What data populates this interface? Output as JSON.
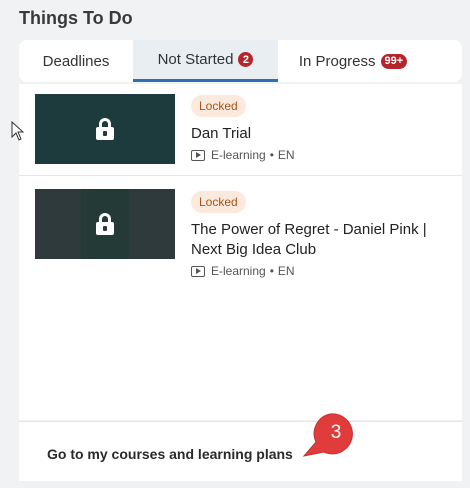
{
  "heading": "Things To Do",
  "tabs": [
    {
      "label": "Deadlines",
      "badge": ""
    },
    {
      "label": "Not Started",
      "badge": "2"
    },
    {
      "label": "In Progress",
      "badge": "99+"
    }
  ],
  "courses": [
    {
      "status": "Locked",
      "title": "Dan Trial",
      "type": "E-learning",
      "separator": "•",
      "lang": "EN",
      "icon": "lock-icon"
    },
    {
      "status": "Locked",
      "title": "The Power of Regret - Daniel Pink | Next Big Idea Club",
      "type": "E-learning",
      "separator": "•",
      "lang": "EN",
      "icon": "lock-icon"
    }
  ],
  "footer": {
    "link": "Go to my courses and learning plans"
  },
  "callout": {
    "number": "3"
  },
  "colors": {
    "accent": "#2f6fb5",
    "badge": "#b3262b",
    "callout": "#e03c3c",
    "locked_bg": "#fbe9dd",
    "locked_text": "#a8541c"
  }
}
